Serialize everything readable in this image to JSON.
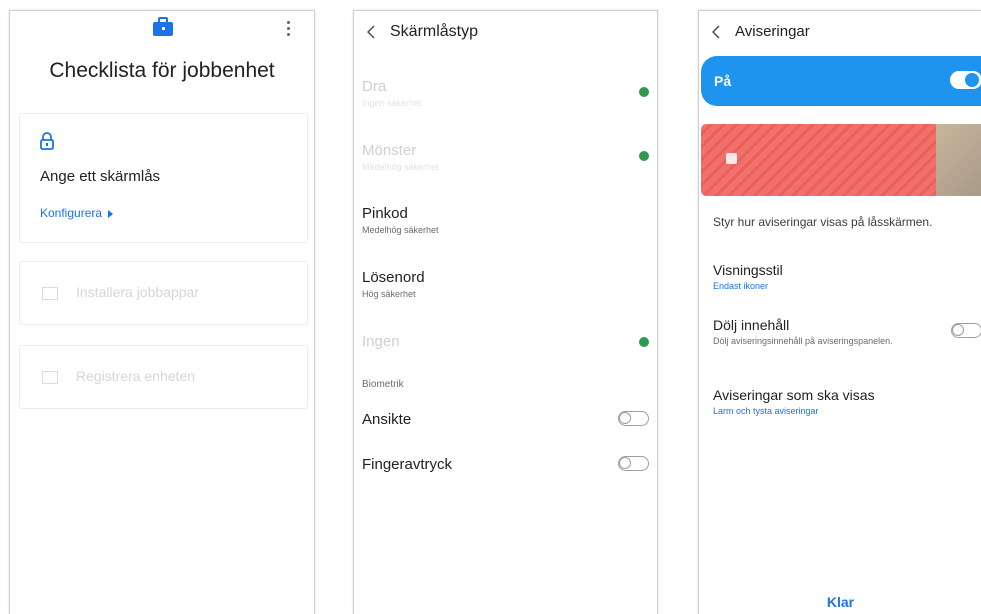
{
  "checklist": {
    "title": "Checklista för jobbenhet",
    "cards": [
      {
        "title": "Ange ett skärmlås",
        "link": "Konfigurera"
      },
      {
        "title": "Installera jobbappar"
      },
      {
        "title": "Registrera enheten"
      }
    ]
  },
  "lock_type": {
    "title": "Skärmlåstyp",
    "options": [
      {
        "label": "Dra",
        "sub": "Ingen säkerhet",
        "disabled": true
      },
      {
        "label": "Mönster",
        "sub": "Medelhög säkerhet",
        "disabled": true
      },
      {
        "label": "Pinkod",
        "sub": "Medelhög säkerhet",
        "disabled": false
      },
      {
        "label": "Lösenord",
        "sub": "Hög säkerhet",
        "disabled": false
      },
      {
        "label": "Ingen",
        "sub": "",
        "disabled": true
      }
    ],
    "biometrics_heading": "Biometrik",
    "biometrics": [
      {
        "label": "Ansikte",
        "enabled": false
      },
      {
        "label": "Fingeravtryck",
        "enabled": false
      }
    ],
    "colors": {
      "info_dot": "#2e9a50"
    }
  },
  "notifications": {
    "title": "Aviseringar",
    "master_label": "På",
    "master_on": true,
    "description": "Styr hur aviseringar visas på låsskärmen.",
    "items": [
      {
        "label": "Visningsstil",
        "sub": "Endast ikoner"
      },
      {
        "label": "Dölj innehåll",
        "sub": "Dölj aviseringsinnehåll på aviseringspanelen."
      },
      {
        "label": "Aviseringar som ska visas",
        "sub": "Larm och tysta aviseringar"
      }
    ],
    "done_label": "Klar",
    "colors": {
      "accent": "#1f94ef",
      "link": "#1a73e8"
    }
  }
}
